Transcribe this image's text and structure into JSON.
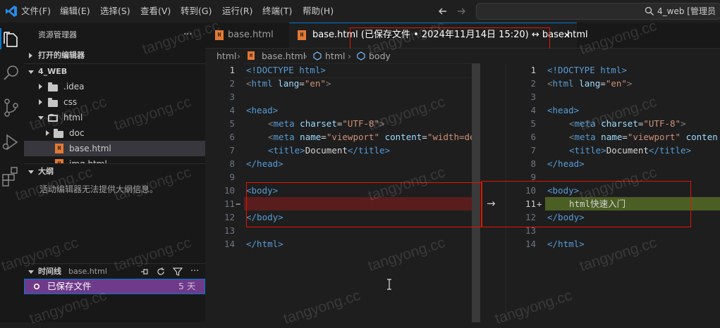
{
  "menu": [
    "文件(F)",
    "编辑(E)",
    "选择(S)",
    "查看(V)",
    "转到(G)",
    "运行(R)",
    "终端(T)",
    "帮助(H)"
  ],
  "search": {
    "text": "4_web [管理员"
  },
  "explorer": {
    "title": "资源管理器",
    "more": "···",
    "open_editors": "打开的编辑器",
    "workspace": "4_WEB",
    "tree": [
      {
        "label": ".idea"
      },
      {
        "label": "css"
      },
      {
        "label": "html"
      },
      {
        "label": "doc"
      },
      {
        "label": "base.html"
      },
      {
        "label": "img.html"
      }
    ]
  },
  "outline": {
    "title": "大纲",
    "message": "活动编辑器无法提供大纲信息。"
  },
  "timeline": {
    "title": "时间线",
    "file": "base.html",
    "entry_label": "已保存文件",
    "entry_age": "5 天"
  },
  "tabs": [
    {
      "label": "base.html"
    },
    {
      "label": "base.html (已保存文件 • 2024年11月14日 15:20) ↔ base.html",
      "close": "✕"
    }
  ],
  "breadcrumb": [
    "html",
    "base.html",
    "html",
    "body"
  ],
  "left_editor": {
    "line_numbers": [
      "1",
      "2",
      "3",
      "4",
      "5",
      "6",
      "7",
      "8",
      "9",
      "10",
      "11",
      "12",
      "13",
      "14"
    ],
    "diff_marker": "−"
  },
  "right_editor": {
    "line_numbers": [
      "1",
      "2",
      "3",
      "4",
      "5",
      "6",
      "7",
      "8",
      "9",
      "10",
      "11",
      "12",
      "13",
      "14"
    ],
    "diff_marker": "+"
  },
  "code": {
    "doctype": "<!DOCTYPE html>",
    "html_open_tag": "html",
    "lang_attr": "lang",
    "lang_val": "\"en\"",
    "head_open": "<head>",
    "meta_tag": "meta",
    "charset_attr": "charset",
    "charset_val": "\"UTF-8\"",
    "name_attr": "name",
    "viewport_val": "\"viewport\"",
    "content_attr": "content",
    "left_content_val": "\"width=dev",
    "right_content_val": "conten",
    "title_open": "<title>",
    "title_text": "Document",
    "title_close": "</title>",
    "head_close": "</head>",
    "body_open": "<body>",
    "body_close": "</body>",
    "html_close": "</html>",
    "added_text": "html快速入门"
  },
  "diff_arrow": "→",
  "watermark": "tangyong.cc",
  "colors": {
    "accent": "#0078d4",
    "removed_line": "#5a1d1d",
    "added_line": "#4b5f25",
    "annotation_red": "#e51400",
    "timeline_selected": "#6f3a8a"
  }
}
